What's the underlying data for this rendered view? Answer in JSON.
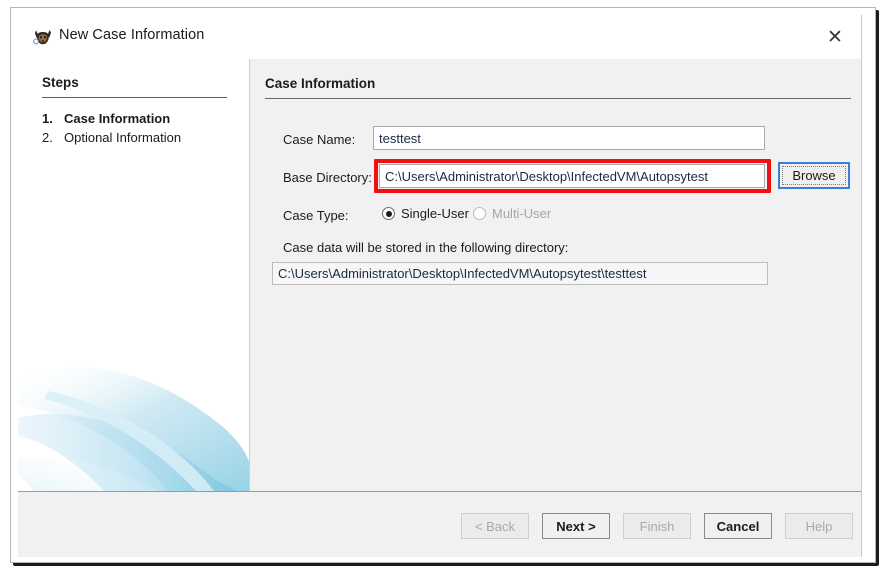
{
  "window": {
    "title": "New Case Information",
    "icon": "autopsy-dog-icon",
    "close_label": "✕"
  },
  "steps_panel": {
    "heading": "Steps",
    "items": [
      {
        "number": "1.",
        "label": "Case Information",
        "active": true
      },
      {
        "number": "2.",
        "label": "Optional Information",
        "active": false
      }
    ]
  },
  "content": {
    "section_title": "Case Information",
    "case_name": {
      "label": "Case Name:",
      "value": "testtest",
      "placeholder": ""
    },
    "base_directory": {
      "label": "Base Directory:",
      "value": "C:\\Users\\Administrator\\Desktop\\InfectedVM\\Autopsytest",
      "placeholder": "",
      "browse_label": "Browse",
      "highlight_color": "#ef1111"
    },
    "case_type": {
      "label": "Case Type:",
      "options": [
        {
          "label": "Single-User",
          "selected": true,
          "disabled": false
        },
        {
          "label": "Multi-User",
          "selected": false,
          "disabled": true
        }
      ]
    },
    "storage_note": {
      "label": "Case data will be stored in the following directory:",
      "value": "C:\\Users\\Administrator\\Desktop\\InfectedVM\\Autopsytest\\testtest"
    }
  },
  "footer": {
    "buttons": [
      {
        "name": "back",
        "label": "< Back",
        "disabled": true,
        "primary": false
      },
      {
        "name": "next",
        "label": "Next >",
        "disabled": false,
        "primary": true
      },
      {
        "name": "finish",
        "label": "Finish",
        "disabled": true,
        "primary": false
      },
      {
        "name": "cancel",
        "label": "Cancel",
        "disabled": false,
        "primary": true
      },
      {
        "name": "help",
        "label": "Help",
        "disabled": true,
        "primary": false
      }
    ]
  }
}
